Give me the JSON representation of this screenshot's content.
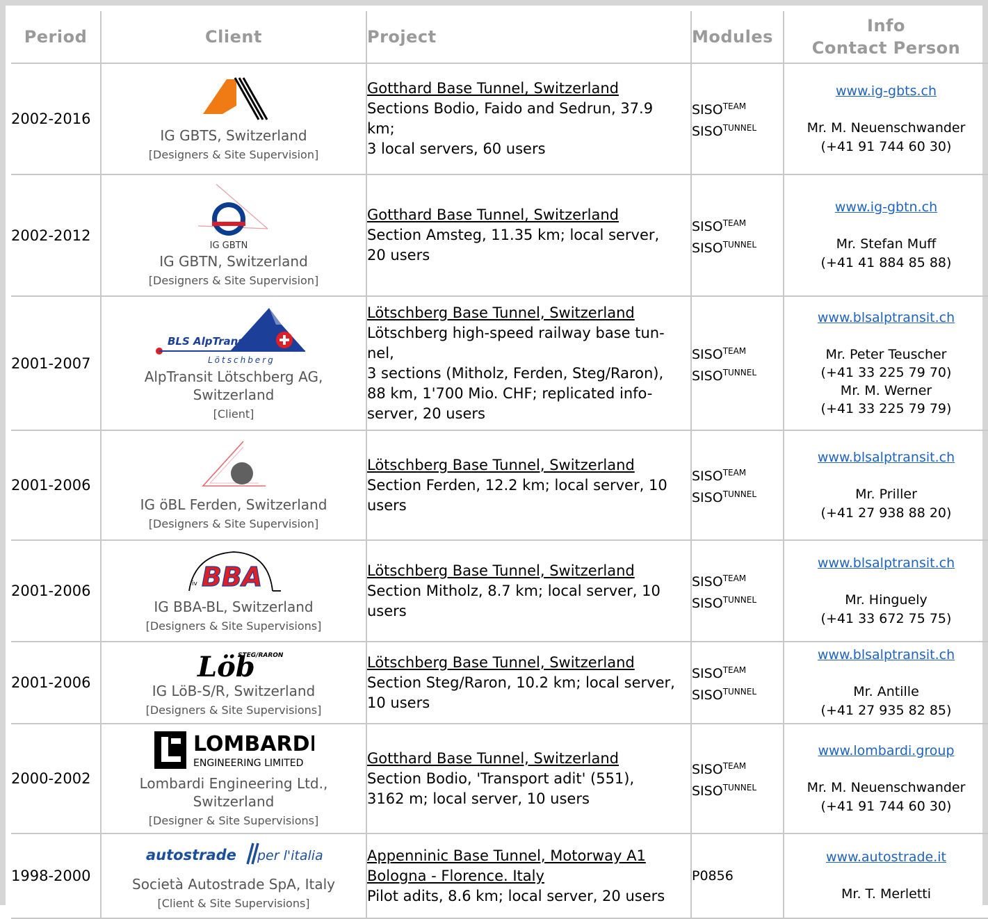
{
  "headers": {
    "period": "Period",
    "client": "Client",
    "project": "Project",
    "modules": "Modules",
    "info_line1": "Info",
    "info_line2": "Contact Person"
  },
  "rows": [
    {
      "period": "2002-2016",
      "logo": "ig-gbts-logo",
      "client_name": "IG GBTS, Switzerland",
      "client_role": "[Designers & Site Supervision]",
      "project_title": "Gotthard Base Tunnel, Switzerland",
      "project_lines": [
        "Sections Bodio, Faido and Sedrun, 37.9",
        "km;",
        "3 local servers, 60 users"
      ],
      "modules": [
        [
          "SISO",
          "TEAM"
        ],
        [
          "SISO",
          "TUNNEL"
        ]
      ],
      "website": "www.ig-gbts.ch",
      "contacts": [
        "Mr. M. Neuenschwander",
        "(+41 91 744 60 30)"
      ]
    },
    {
      "period": "2002-2012",
      "logo": "ig-gbtn-logo",
      "logo_text": "IG GBTN",
      "client_name": "IG GBTN, Switzerland",
      "client_role": "[Designers & Site Supervision]",
      "project_title": "Gotthard Base Tunnel, Switzerland",
      "project_lines": [
        "Section Amsteg, 11.35 km; local server,",
        "20 users"
      ],
      "modules": [
        [
          "SISO",
          "TEAM"
        ],
        [
          "SISO",
          "TUNNEL"
        ]
      ],
      "website": "www.ig-gbtn.ch",
      "contacts": [
        "Mr. Stefan Muff",
        "(+41 41 884 85 88)"
      ]
    },
    {
      "period": "2001-2007",
      "logo": "bls-alptransit-logo",
      "logo_text": "BLS AlpTransit",
      "logo_subtext": "Lötschberg",
      "client_name_lines": [
        "AlpTransit Lötschberg AG,",
        "Switzerland"
      ],
      "client_role": "[Client]",
      "project_title": "Lötschberg Base Tunnel, Switzerland",
      "project_lines": [
        "Lötschberg high-speed railway base tun-",
        "nel,",
        "3 sections (Mitholz, Ferden, Steg/Raron),",
        "88 km, 1'700 Mio. CHF; replicated info-",
        "server, 20 users"
      ],
      "modules": [
        [
          "SISO",
          "TEAM"
        ],
        [
          "SISO",
          "TUNNEL"
        ]
      ],
      "website": "www.blsalptransit.ch",
      "contacts": [
        "Mr. Peter Teuscher",
        "(+41 33 225 79 70)",
        "Mr. M. Werner",
        "(+41 33 225 79 79)"
      ]
    },
    {
      "period": "2001-2006",
      "logo": "ig-obl-ferden-logo",
      "client_name": "IG öBL Ferden, Switzerland",
      "client_role": "[Designers & Site Supervision]",
      "project_title": "Lötschberg Base Tunnel, Switzerland",
      "project_lines": [
        "Section Ferden, 12.2 km; local server, 10",
        "users"
      ],
      "modules": [
        [
          "SISO",
          "TEAM"
        ],
        [
          "SISO",
          "TUNNEL"
        ]
      ],
      "website": "www.blsalptransit.ch",
      "contacts": [
        "Mr. Priller",
        "(+41 27 938 88 20)"
      ]
    },
    {
      "period": "2001-2006",
      "logo": "ig-bba-logo",
      "logo_text": "BBA",
      "logo_small": "iv",
      "client_name": "IG BBA-BL, Switzerland",
      "client_role": "[Designers & Site Supervisions]",
      "project_title": "Lötschberg Base Tunnel, Switzerland",
      "project_lines": [
        "Section Mitholz, 8.7 km; local server, 10",
        "users"
      ],
      "modules": [
        [
          "SISO",
          "TEAM"
        ],
        [
          "SISO",
          "TUNNEL"
        ]
      ],
      "website": "www.blsalptransit.ch",
      "contacts": [
        "Mr. Hinguely",
        "(+41 33 672 75 75)"
      ]
    },
    {
      "period": "2001-2006",
      "logo": "ig-lob-logo",
      "logo_text": "Löb",
      "logo_small": "STEG/RARON",
      "client_name": "IG LöB-S/R, Switzerland",
      "client_role": "[Designers & Site Supervisions]",
      "project_title": "Lötschberg Base Tunnel, Switzerland",
      "project_lines": [
        "Section Steg/Raron, 10.2 km; local server,",
        "10 users"
      ],
      "modules": [
        [
          "SISO",
          "TEAM"
        ],
        [
          "SISO",
          "TUNNEL"
        ]
      ],
      "website": "www.blsalptransit.ch",
      "contacts": [
        "Mr. Antille",
        "(+41 27 935 82 85)"
      ]
    },
    {
      "period": "2000-2002",
      "logo": "lombardi-logo",
      "logo_text": "LOMBARDI",
      "logo_subtext": "ENGINEERING LIMITED",
      "client_name_lines": [
        "Lombardi Engineering Ltd.,",
        "Switzerland"
      ],
      "client_role": "[Designer & Site Supervisions]",
      "project_title": "Gotthard Base Tunnel, Switzerland",
      "project_lines": [
        "Section Bodio, 'Transport adit' (551),",
        "3162 m; local server, 10 users"
      ],
      "modules": [
        [
          "SISO",
          "TEAM"
        ],
        [
          "SISO",
          "TUNNEL"
        ]
      ],
      "website": "www.lombardi.group",
      "contacts": [
        "Mr. M. Neuenschwander",
        "(+41 91 744 60 30)"
      ]
    },
    {
      "period": "1998-2000",
      "logo": "autostrade-logo",
      "logo_text": "autostrade",
      "logo_subtext": "per l'italia",
      "client_name": "Società Autostrade SpA, Italy",
      "client_role": "[Client & Site Supervisions]",
      "project_title_lines": [
        "Appenninic Base Tunnel, Motorway A1",
        "Bologna - Florence. Italy"
      ],
      "project_lines": [
        "Pilot adits, 8.6 km; local server, 20 users"
      ],
      "modules_text": "P0856",
      "website": "www.autostrade.it",
      "contacts": [
        "Mr. T. Merletti"
      ]
    }
  ]
}
